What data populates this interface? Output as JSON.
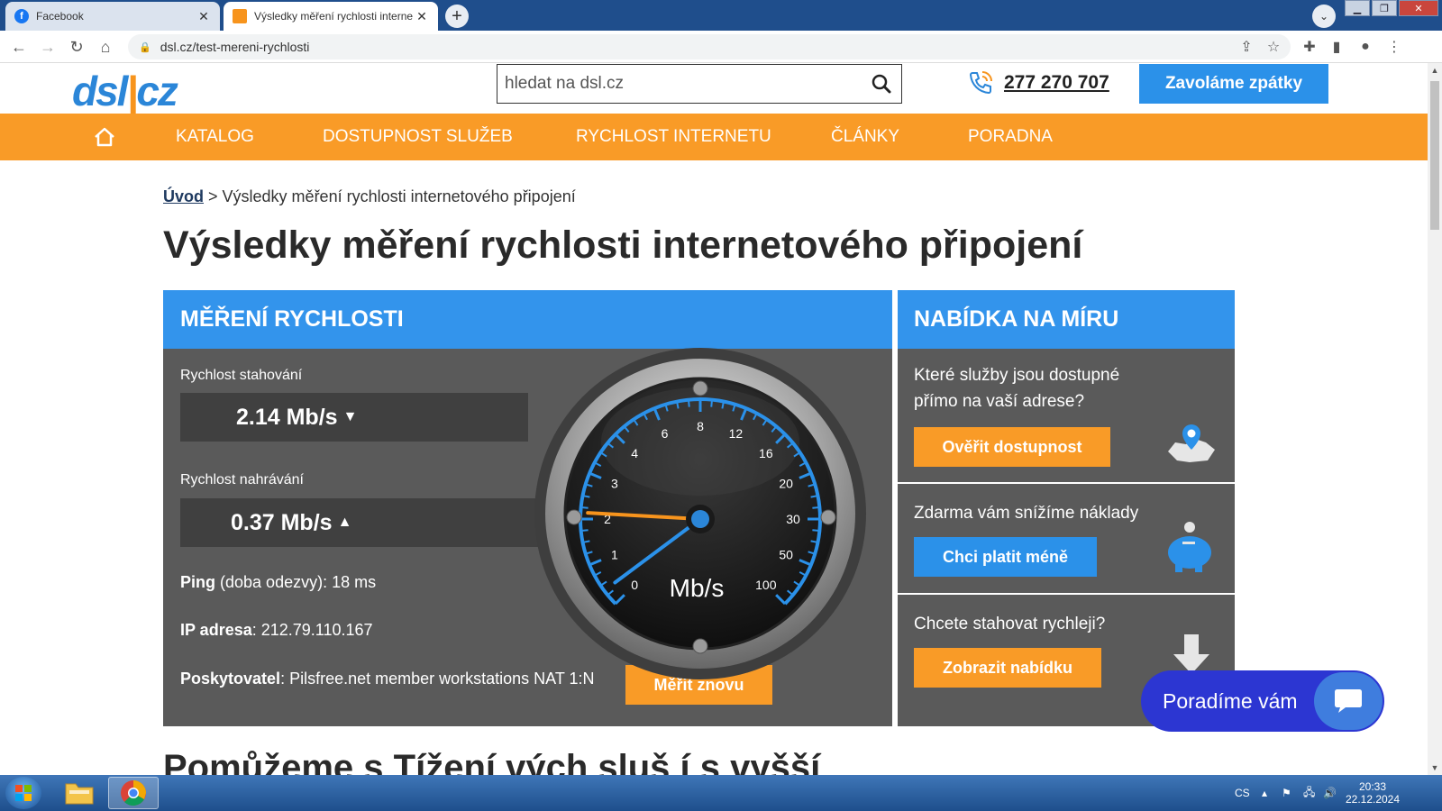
{
  "browser": {
    "tabs": [
      {
        "label": "Facebook",
        "icon": "facebook-icon"
      },
      {
        "label": "Výsledky měření rychlosti interne",
        "icon": "dsl-favicon"
      }
    ],
    "url": "dsl.cz/test-mereni-rychlosti"
  },
  "header": {
    "logo_left": "dsl",
    "logo_sep": "|",
    "logo_right": "cz",
    "search_placeholder": "hledat na dsl.cz",
    "phone": "277 270 707",
    "callback_label": "Zavoláme zpátky"
  },
  "menu": {
    "items": [
      "KATALOG",
      "DOSTUPNOST SLUŽEB",
      "RYCHLOST INTERNETU",
      "ČLÁNKY",
      "PORADNA"
    ]
  },
  "breadcrumb": {
    "home": "Úvod",
    "current": "Výsledky měření rychlosti internetového připojení"
  },
  "page_title": "Výsledky měření rychlosti internetového připojení",
  "measure": {
    "heading": "MĚŘENÍ RYCHLOSTI",
    "download_label": "Rychlost stahování",
    "download_value": "2.14 Mb/s",
    "upload_label": "Rychlost nahrávání",
    "upload_value": "0.37 Mb/s",
    "ping_key": "Ping",
    "ping_value": "(doba odezvy): 18 ms",
    "ip_key": "IP adresa",
    "ip_value": ": 212.79.110.167",
    "provider_key": "Poskytovatel",
    "provider_value": ": Pilsfree.net member workstations NAT 1:N",
    "again_label": "Měřit znovu"
  },
  "gauge": {
    "unit": "Mb/s",
    "ticks": [
      "0",
      "1",
      "2",
      "3",
      "4",
      "6",
      "8",
      "12",
      "16",
      "20",
      "30",
      "50",
      "100"
    ],
    "download_needle": 2.14,
    "upload_needle": 0.37,
    "download_color": "#f7941d",
    "upload_color": "#2b91e9"
  },
  "offers": {
    "heading": "NABÍDKA NA MÍRU",
    "items": [
      {
        "text": "Které služby jsou dostupné přímo na vaší adrese?",
        "button": "Ověřit dostupnost",
        "button_color": "#f99b27",
        "icon": "map-pin-icon"
      },
      {
        "text": "Zdarma vám snížíme náklady",
        "button": "Chci platit méně",
        "button_color": "#2b91e9",
        "icon": "piggy-bank-icon"
      },
      {
        "text": "Chcete stahovat rychleji?",
        "button": "Zobrazit nabídku",
        "button_color": "#f99b27",
        "icon": "download-arrow-icon"
      }
    ]
  },
  "chat": {
    "label": "Poradíme vám"
  },
  "next_heading": "Pomůžeme s Tížení vých sluš í s vyšší",
  "taskbar": {
    "lang": "CS",
    "time": "20:33",
    "date": "22.12.2024"
  },
  "colors": {
    "brand_blue": "#3394ec",
    "brand_orange": "#f99b27",
    "panel_gray": "#5a5a5a",
    "chat_blue": "#2c36d2"
  }
}
